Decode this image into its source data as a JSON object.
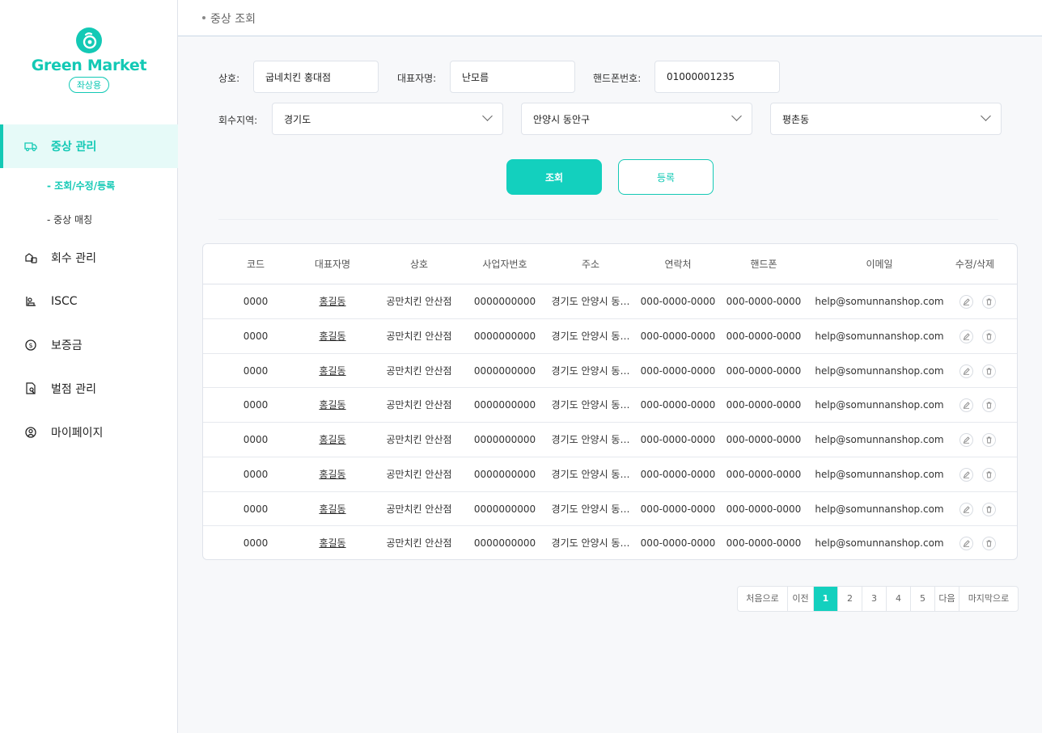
{
  "brand": {
    "name": "Green Market",
    "badge": "좌상용"
  },
  "nav": {
    "items": [
      {
        "label": "중상 관리",
        "icon": "truck-icon"
      },
      {
        "label": "회수 관리",
        "icon": "recycle-box-icon"
      },
      {
        "label": "ISCC",
        "icon": "certificate-icon"
      },
      {
        "label": "보증금",
        "icon": "coin-icon"
      },
      {
        "label": "벌점 관리",
        "icon": "penalty-icon"
      },
      {
        "label": "마이페이지",
        "icon": "user-circle-icon"
      }
    ],
    "sub_items": [
      {
        "label": "- 조회/수정/등록"
      },
      {
        "label": "- 중상 매칭"
      }
    ]
  },
  "breadcrumb": "중상 조회",
  "search": {
    "name_label": "상호:",
    "name_value": "굽네치킨 홍대점",
    "rep_label": "대표자명:",
    "rep_value": "난모름",
    "phone_label": "핸드폰번호:",
    "phone_value": "01000001235",
    "region_label": "회수지역:",
    "region1": "경기도",
    "region2": "안양시 동안구",
    "region3": "평촌동",
    "search_button": "조회",
    "register_button": "등록"
  },
  "table": {
    "headers": [
      "코드",
      "대표자명",
      "상호",
      "사업자번호",
      "주소",
      "연락처",
      "핸드폰",
      "이메일",
      "수정/삭제"
    ],
    "rows": [
      [
        "0000",
        "홍길동",
        "공만치킨 안산점",
        "0000000000",
        "경기도 안양시 동…",
        "000-0000-0000",
        "000-0000-0000",
        "help@somunnanshop.com"
      ],
      [
        "0000",
        "홍길동",
        "공만치킨 안산점",
        "0000000000",
        "경기도 안양시 동…",
        "000-0000-0000",
        "000-0000-0000",
        "help@somunnanshop.com"
      ],
      [
        "0000",
        "홍길동",
        "공만치킨 안산점",
        "0000000000",
        "경기도 안양시 동…",
        "000-0000-0000",
        "000-0000-0000",
        "help@somunnanshop.com"
      ],
      [
        "0000",
        "홍길동",
        "공만치킨 안산점",
        "0000000000",
        "경기도 안양시 동…",
        "000-0000-0000",
        "000-0000-0000",
        "help@somunnanshop.com"
      ],
      [
        "0000",
        "홍길동",
        "공만치킨 안산점",
        "0000000000",
        "경기도 안양시 동…",
        "000-0000-0000",
        "000-0000-0000",
        "help@somunnanshop.com"
      ],
      [
        "0000",
        "홍길동",
        "공만치킨 안산점",
        "0000000000",
        "경기도 안양시 동…",
        "000-0000-0000",
        "000-0000-0000",
        "help@somunnanshop.com"
      ],
      [
        "0000",
        "홍길동",
        "공만치킨 안산점",
        "0000000000",
        "경기도 안양시 동…",
        "000-0000-0000",
        "000-0000-0000",
        "help@somunnanshop.com"
      ],
      [
        "0000",
        "홍길동",
        "공만치킨 안산점",
        "0000000000",
        "경기도 안양시 동…",
        "000-0000-0000",
        "000-0000-0000",
        "help@somunnanshop.com"
      ]
    ]
  },
  "pagination": {
    "first": "처음으로",
    "prev": "이전",
    "pages": [
      "1",
      "2",
      "3",
      "4",
      "5"
    ],
    "current": "1",
    "next": "다음",
    "last": "마지막으로"
  },
  "colors": {
    "accent": "#13d0be",
    "border": "#dfe3ea"
  }
}
